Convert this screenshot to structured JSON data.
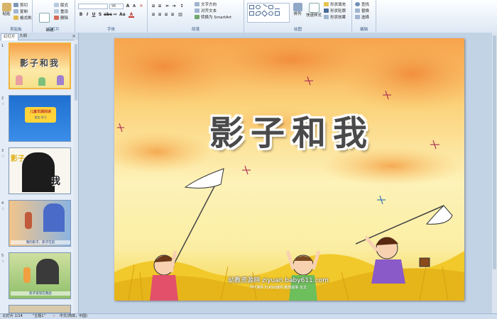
{
  "ribbon": {
    "clipboard": {
      "label": "剪贴板",
      "paste": "粘贴",
      "cut": "剪切",
      "copy": "复制",
      "format_painter": "格式刷"
    },
    "slides": {
      "label": "幻灯片",
      "new_slide": "新建\n幻灯片",
      "layout": "版式",
      "reset": "重设",
      "delete": "删除"
    },
    "font": {
      "label": "字体",
      "font_name": "",
      "font_size": "96"
    },
    "paragraph": {
      "label": "段落",
      "text_direction": "文字方向",
      "align_text": "对齐文本",
      "smartart": "转换为 SmartArt"
    },
    "drawing": {
      "label": "绘图",
      "arrange": "排列",
      "quick_styles": "快速样式",
      "shape_fill": "形状填充",
      "shape_outline": "形状轮廓",
      "shape_effects": "形状效果"
    },
    "editing": {
      "label": "编辑",
      "find": "查找",
      "replace": "替换",
      "select": "选择"
    }
  },
  "panel": {
    "tabs": [
      "幻灯片",
      "大纲"
    ],
    "close_glyph": "×",
    "slides": [
      {
        "num": "1",
        "title": "影子和我"
      },
      {
        "num": "2",
        "title": "儿童早期阅读",
        "subtitle": "语言·学习"
      },
      {
        "num": "3",
        "title": "影子",
        "word": "我"
      },
      {
        "num": "4",
        "caption": "我的影子，影子在前"
      },
      {
        "num": "5",
        "caption": "影子常常在我后"
      }
    ]
  },
  "slide": {
    "title": "影子和我",
    "watermark": "幼教资源网 ziyuan.baby611.com",
    "watermark_sub": "PPT课件  FLASH课件  教育故事  论文"
  },
  "status": {
    "slide_info": "幻灯片 1/14",
    "theme": "\"主题1\"",
    "language": "中文(简体，中国)"
  },
  "colors": {
    "ribbon_top": "#fdfeff",
    "ribbon_bottom": "#dde8f5",
    "panel": "#e3ecf7",
    "stage": "#c3d3e6",
    "selection": "#f3b33d"
  }
}
